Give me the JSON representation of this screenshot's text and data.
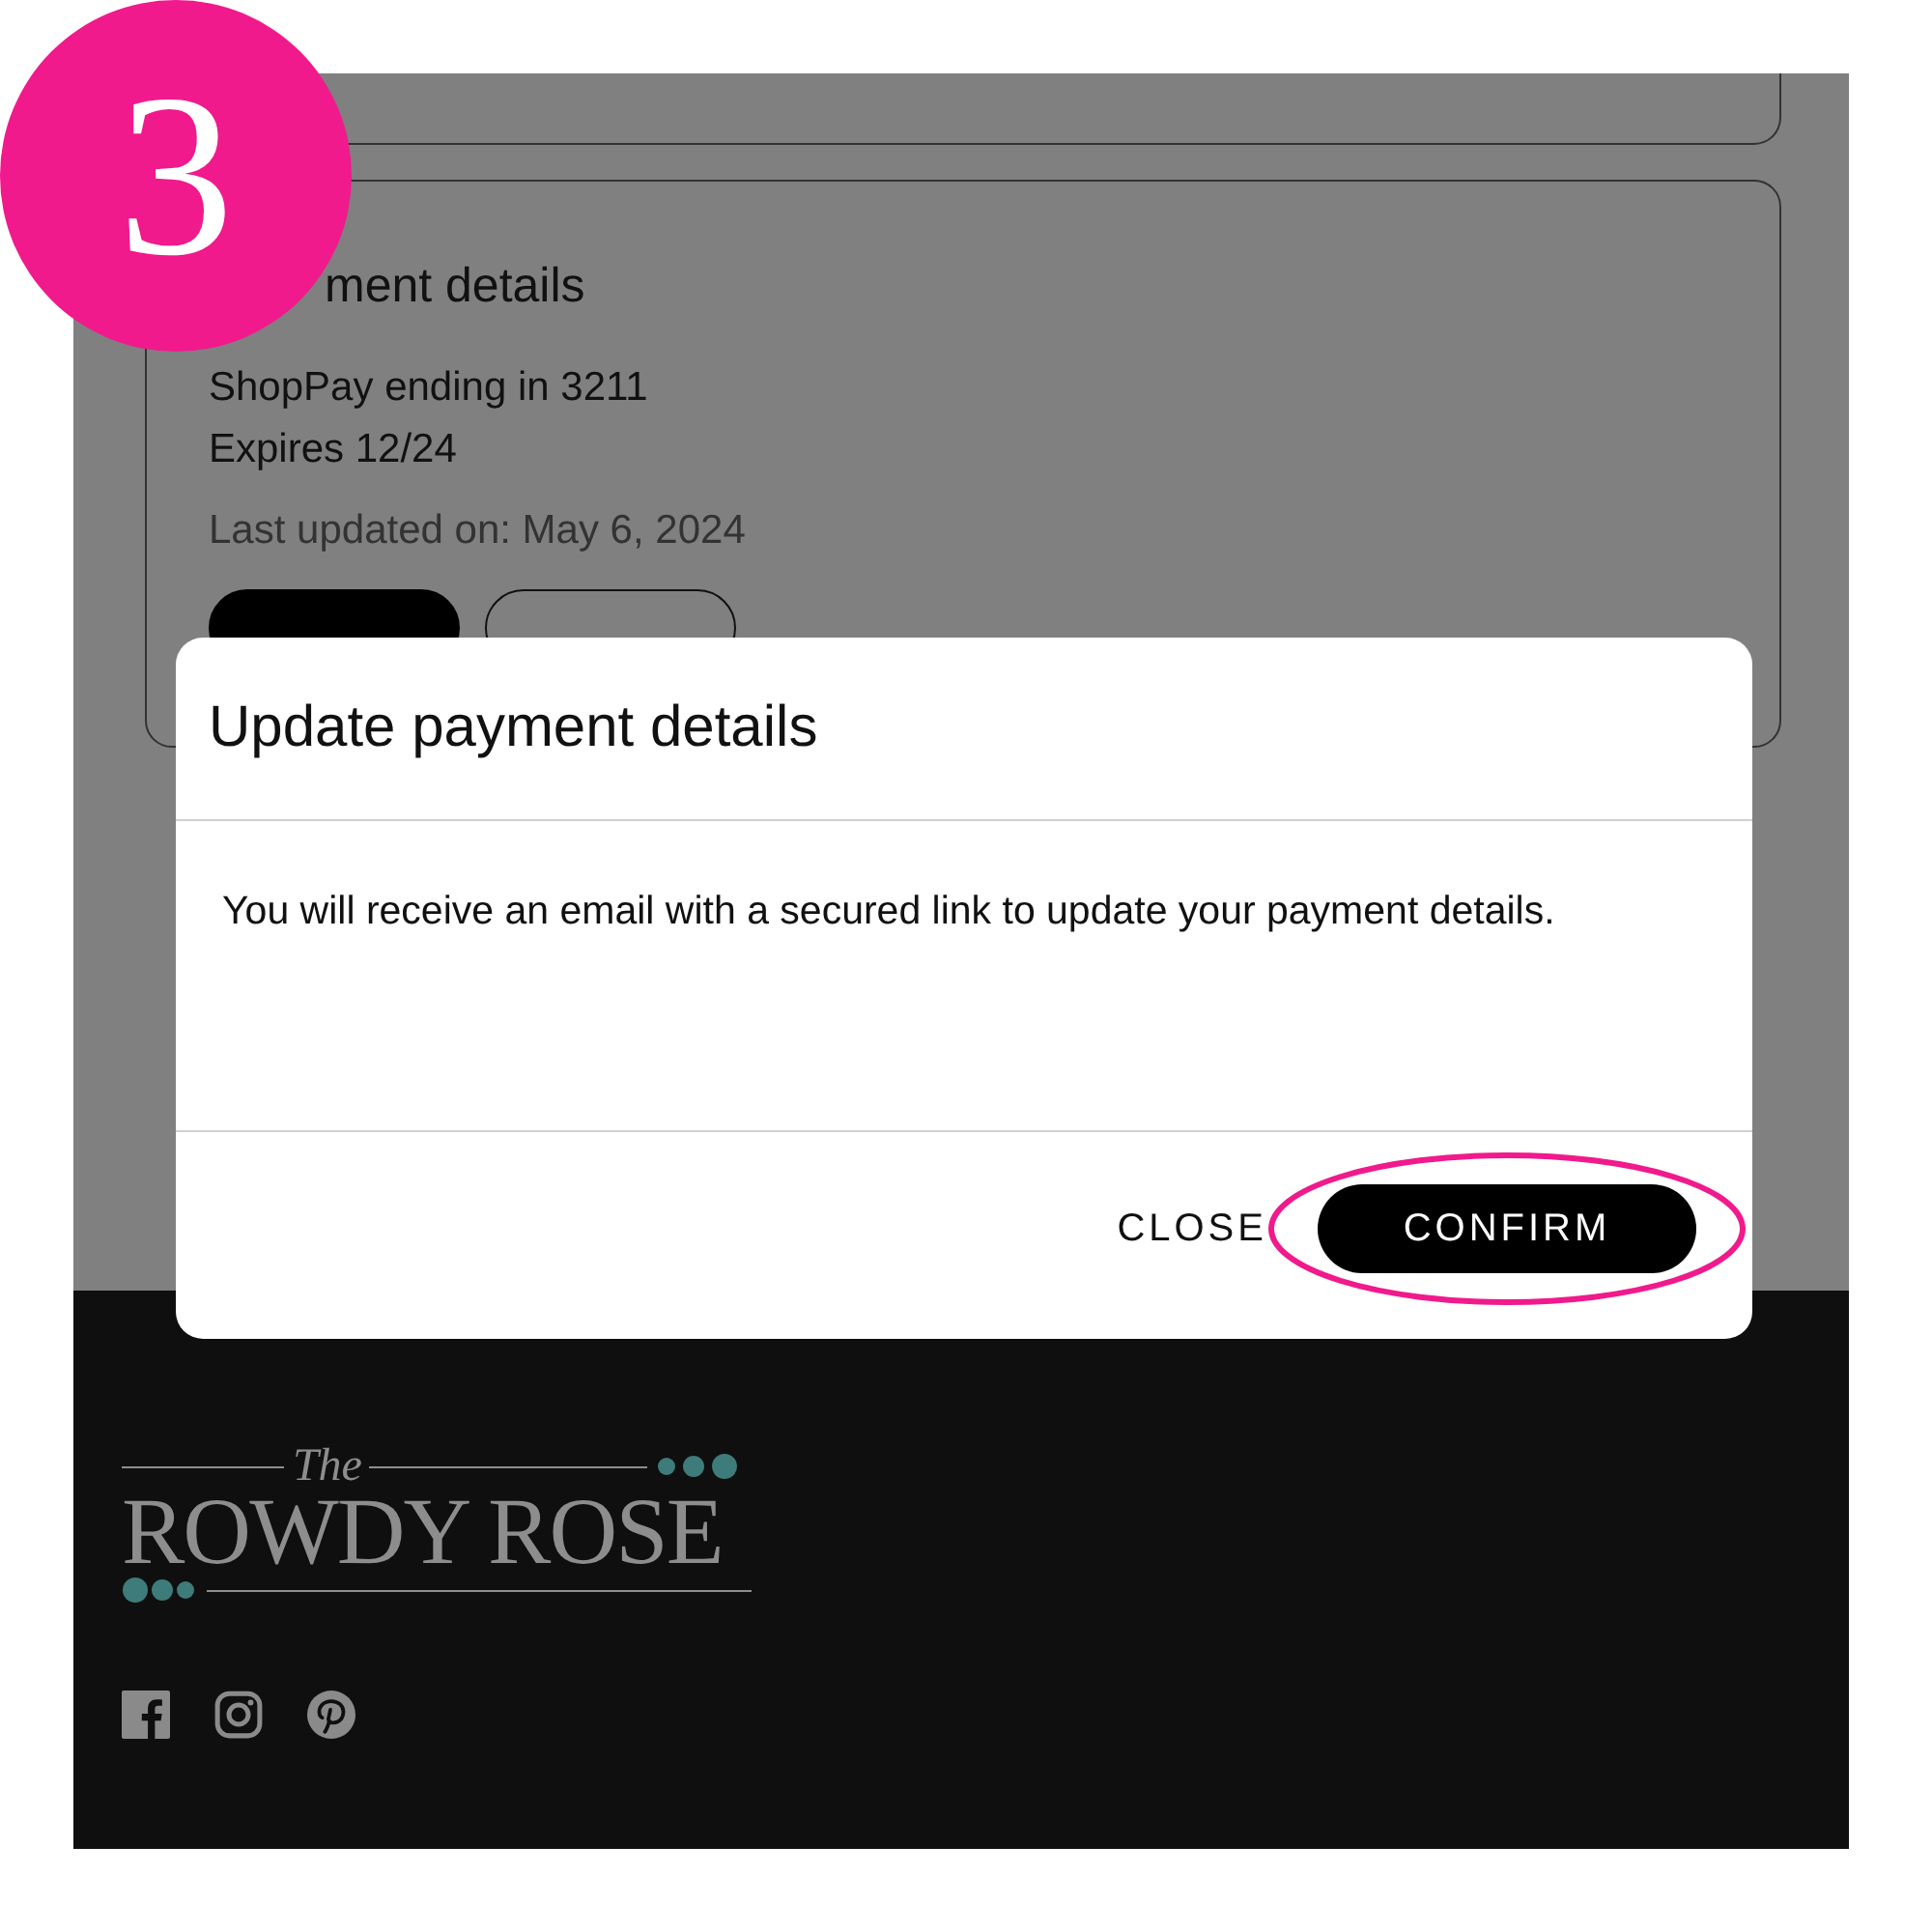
{
  "annotation": {
    "step": "3"
  },
  "payment_card": {
    "heading": "ment details",
    "method": "ShopPay ending in 3211",
    "expiry": "Expires 12/24",
    "updated": "Last updated on: May 6, 2024",
    "buttons": [
      {
        "kind": "primary"
      },
      {
        "kind": "secondary"
      }
    ]
  },
  "dialog": {
    "title": "Update payment details",
    "message": "You will receive an email with a secured link to update your payment details.",
    "buttons": [
      {
        "label": "CLOSE",
        "kind": "secondary",
        "highlighted": false
      },
      {
        "label": "CONFIRM",
        "kind": "primary",
        "highlighted": true
      }
    ]
  },
  "footer": {
    "logo": {
      "small": "The",
      "main": "ROWDY ROSE"
    },
    "social": [
      {
        "kind": "facebook"
      },
      {
        "kind": "instagram"
      },
      {
        "kind": "pinterest"
      }
    ]
  }
}
